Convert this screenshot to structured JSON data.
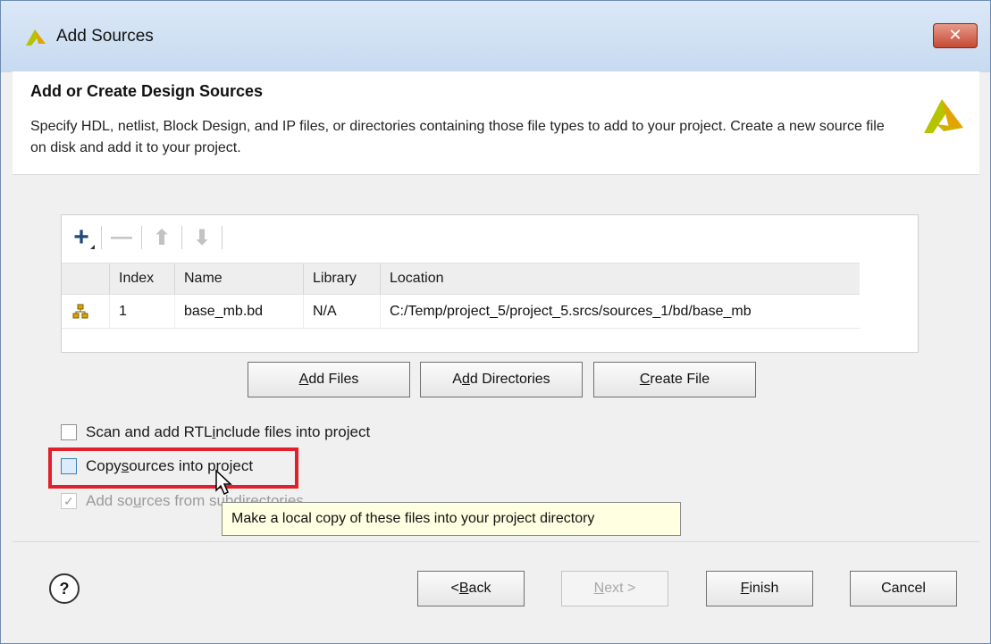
{
  "window": {
    "title": "Add Sources",
    "close_label": "✕"
  },
  "header": {
    "title": "Add or Create Design Sources",
    "description": "Specify HDL, netlist, Block Design, and IP files, or directories containing those file types to add to your project. Create a new source file on disk and add it to your project."
  },
  "toolbar": {
    "add_symbol": "+",
    "remove_symbol": "—",
    "up_symbol": "⬆",
    "down_symbol": "⬇"
  },
  "table": {
    "columns": [
      "",
      "Index",
      "Name",
      "Library",
      "Location"
    ],
    "rows": [
      {
        "icon": "block-design-icon",
        "index": "1",
        "name": "base_mb.bd",
        "library": "N/A",
        "location": "C:/Temp/project_5/project_5.srcs/sources_1/bd/base_mb"
      }
    ]
  },
  "buttons": {
    "add_files": {
      "accel": "A",
      "rest": "dd Files"
    },
    "add_directories": {
      "pre": "A",
      "accel": "d",
      "rest": "d Directories"
    },
    "create_file": {
      "accel": "C",
      "rest": "reate File"
    }
  },
  "options": {
    "scan_rtl": {
      "pre": "Scan and add RTL ",
      "accel": "i",
      "rest": "nclude files into project",
      "checked": false
    },
    "copy_sources": {
      "pre": "Copy ",
      "accel": "s",
      "rest": "ources into project",
      "checked": false
    },
    "add_subdirs": {
      "pre": "Add so",
      "accel": "u",
      "rest": "rces from subdirectories",
      "checked": true,
      "enabled": false
    }
  },
  "tooltip": "Make a local copy of these files into your project directory",
  "footer": {
    "help": "?",
    "back": {
      "pre": "< ",
      "accel": "B",
      "rest": "ack"
    },
    "next": {
      "accel": "N",
      "rest": "ext >"
    },
    "finish": {
      "accel": "F",
      "rest": "inish"
    },
    "cancel": "Cancel"
  },
  "colors": {
    "highlight": "#e0202a",
    "logo": "#b5c400",
    "tooltip_bg": "#ffffe1"
  }
}
